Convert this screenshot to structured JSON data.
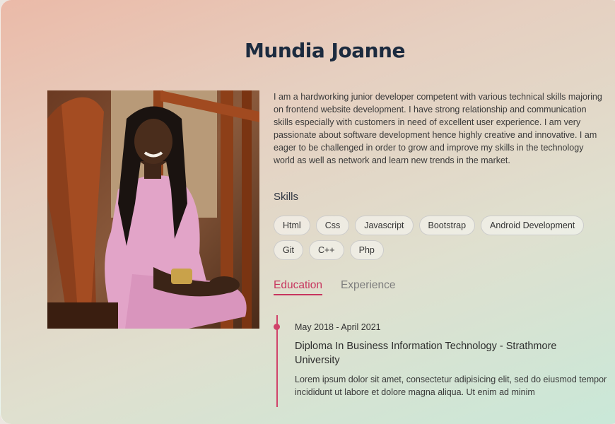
{
  "profile": {
    "name": "Mundia Joanne",
    "bio": "I am a hardworking junior developer competent with various technical skills majoring on frontend website development. I have strong relationship and communication skills especially with customers in need of excellent user experience. I am very passionate about software development hence highly creative and innovative. I am eager to be challenged in order to grow and improve my skills in the technology world as well as network and learn new trends in the market."
  },
  "skills": {
    "title": "Skills",
    "items": [
      "Html",
      "Css",
      "Javascript",
      "Bootstrap",
      "Android Development",
      "Git",
      "C++",
      "Php"
    ]
  },
  "tabs": {
    "education": "Education",
    "experience": "Experience"
  },
  "timeline": {
    "date": "May 2018 - April 2021",
    "title": "Diploma In Business Information Technology - Strathmore University",
    "description": "Lorem ipsum dolor sit amet, consectetur adipisicing elit, sed do eiusmod tempor incididunt ut labore et dolore magna aliqua. Ut enim ad minim"
  },
  "colors": {
    "accent": "#c7355e",
    "title": "#1c2b3f"
  }
}
